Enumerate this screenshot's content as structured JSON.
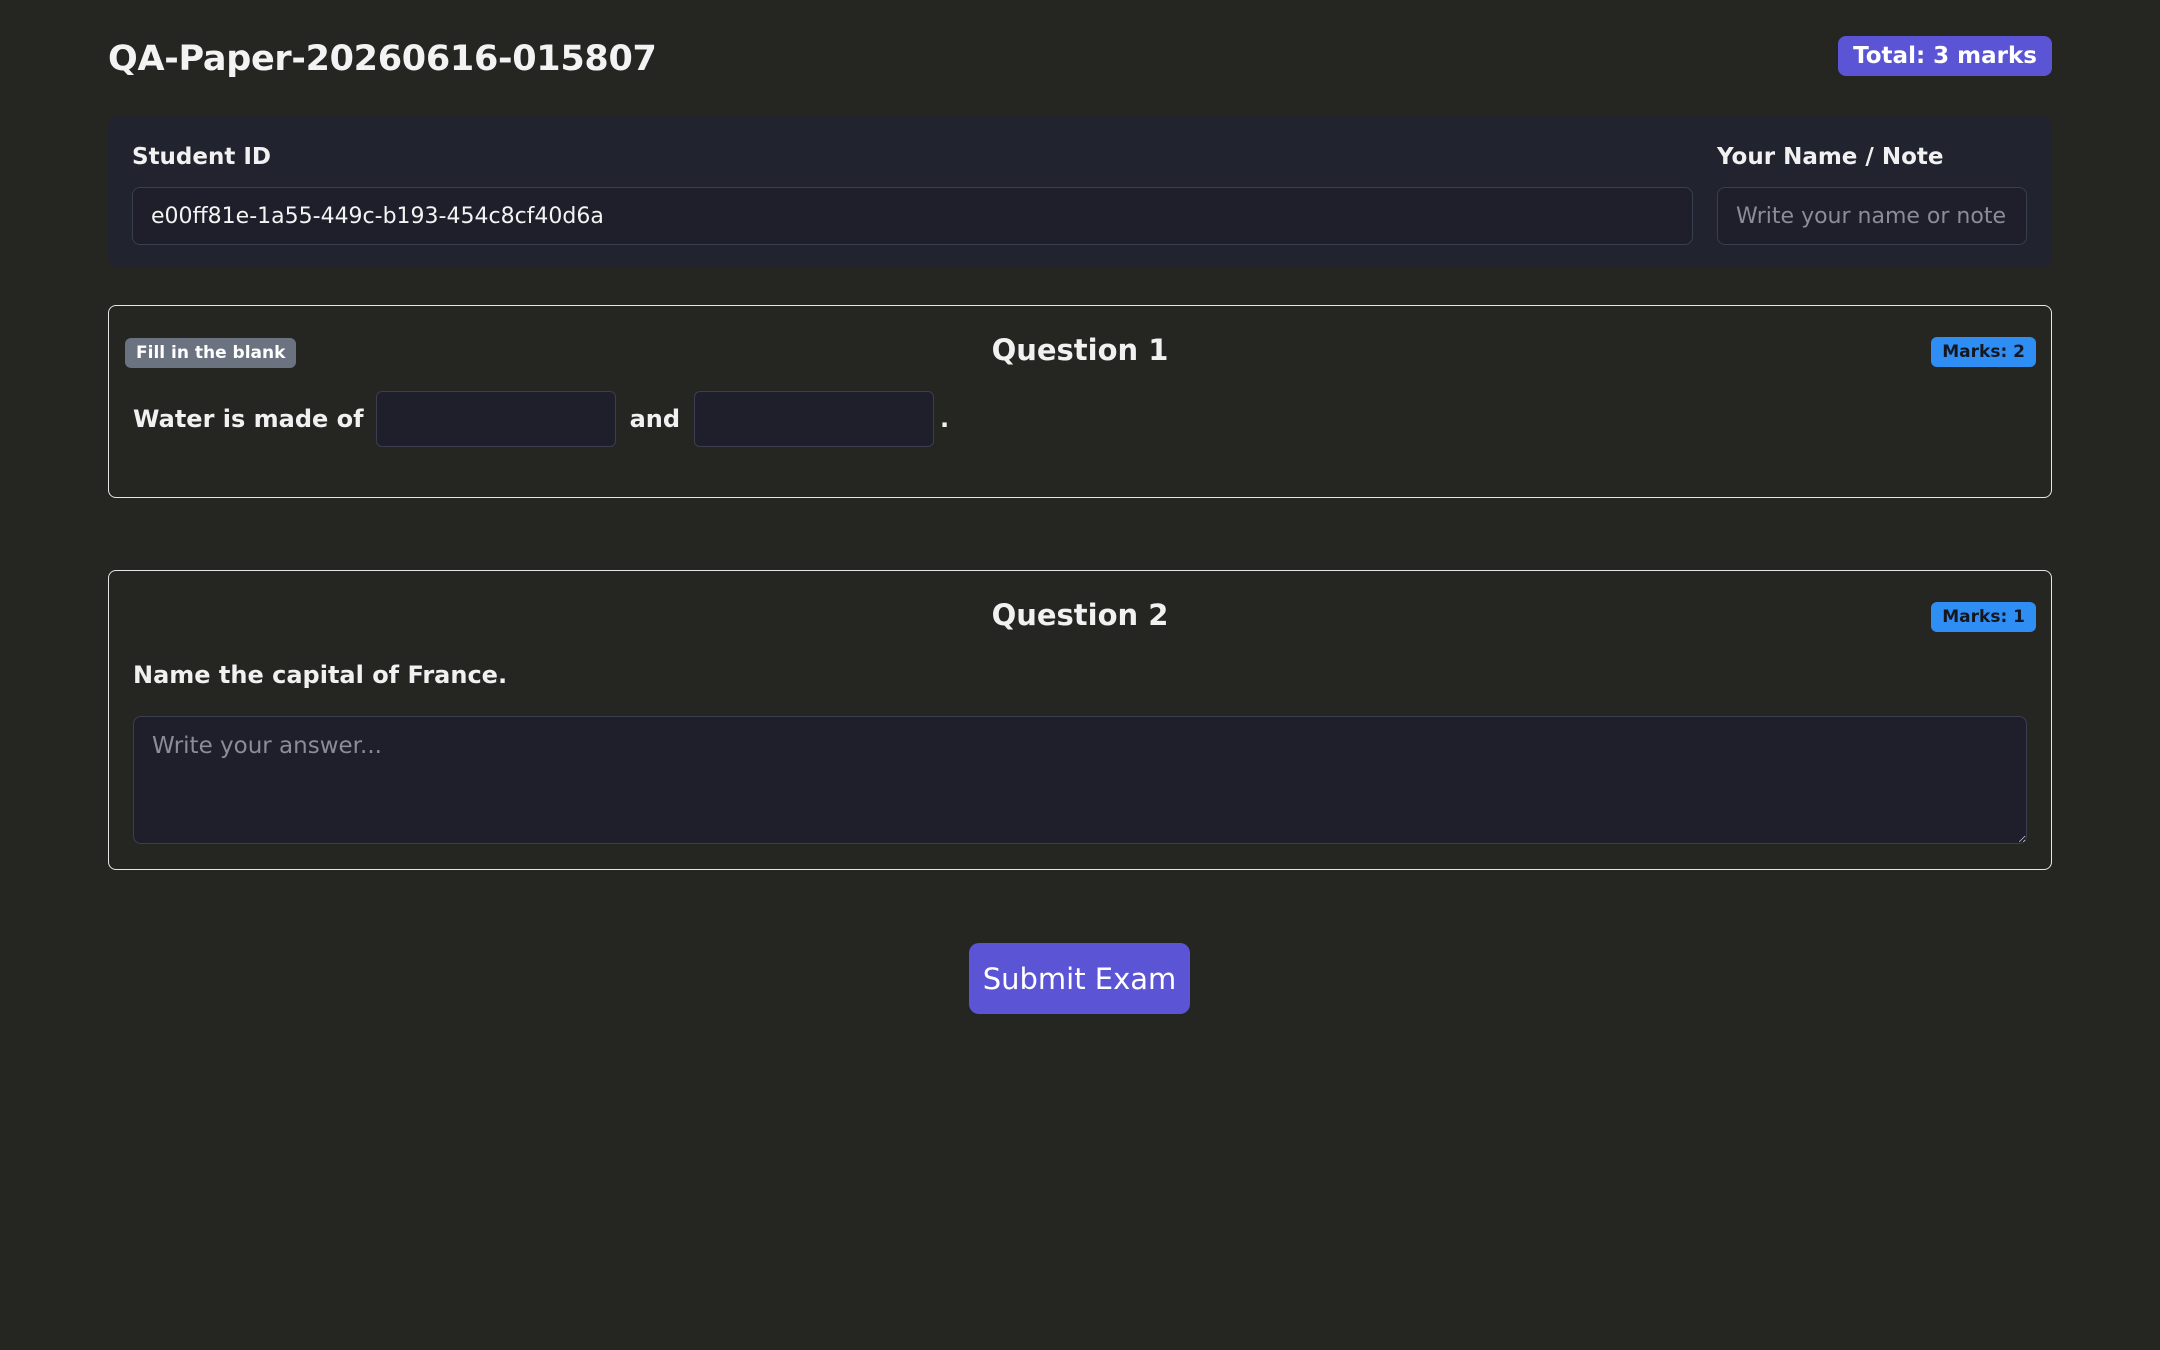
{
  "header": {
    "title": "QA-Paper-20260616-015807",
    "total_badge": "Total: 3 marks"
  },
  "student": {
    "id_label": "Student ID",
    "id_value": "e00ff81e-1a55-449c-b193-454c8cf40d6a",
    "name_label": "Your Name / Note",
    "name_placeholder": "Write your name or note here"
  },
  "questions": [
    {
      "type_badge": "Fill in the blank",
      "title": "Question 1",
      "marks_badge": "Marks: 2",
      "segments": [
        "Water is made of",
        "and",
        "."
      ],
      "blanks": [
        "",
        ""
      ]
    },
    {
      "title": "Question 2",
      "marks_badge": "Marks: 1",
      "prompt": "Name the capital of France.",
      "answer_placeholder": "Write your answer..."
    }
  ],
  "submit": {
    "label": "Submit Exam"
  },
  "colors": {
    "background": "#252622",
    "panel": "#21242e",
    "accent": "#5b55d6",
    "marks_badge": "#2f8ef4",
    "type_badge": "#6b7280"
  }
}
